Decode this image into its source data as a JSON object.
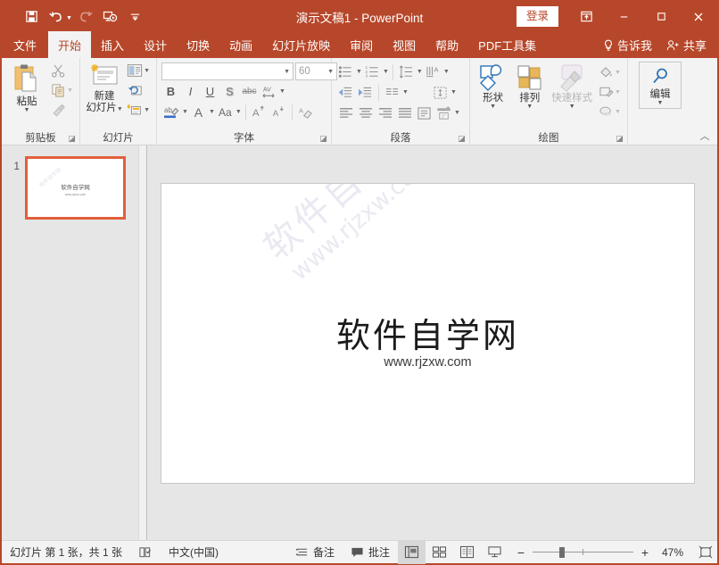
{
  "titlebar": {
    "document_title": "演示文稿1  -  PowerPoint",
    "signin_label": "登录",
    "quick_access": [
      {
        "name": "save-icon",
        "label": "保存"
      },
      {
        "name": "undo-icon",
        "label": "撤销"
      },
      {
        "name": "redo-icon",
        "label": "恢复"
      },
      {
        "name": "start-slideshow-icon",
        "label": "从头开始"
      },
      {
        "name": "customize-qat-icon",
        "label": "自定义快速访问工具栏"
      }
    ],
    "window_controls": {
      "ribbon_display_options": "功能区显示选项",
      "minimize": "最小化",
      "maximize": "最大化",
      "close": "关闭"
    },
    "bg_color": "#b7472a"
  },
  "tabs": [
    {
      "label": "文件",
      "active": false
    },
    {
      "label": "开始",
      "active": true
    },
    {
      "label": "插入",
      "active": false
    },
    {
      "label": "设计",
      "active": false
    },
    {
      "label": "切换",
      "active": false
    },
    {
      "label": "动画",
      "active": false
    },
    {
      "label": "幻灯片放映",
      "active": false
    },
    {
      "label": "审阅",
      "active": false
    },
    {
      "label": "视图",
      "active": false
    },
    {
      "label": "帮助",
      "active": false
    },
    {
      "label": "PDF工具集",
      "active": false
    }
  ],
  "tab_right": {
    "tell_me": "告诉我",
    "share": "共享"
  },
  "ribbon": {
    "groups": [
      {
        "label": "剪贴板",
        "buttons": {
          "paste": "粘贴",
          "cut": "剪切",
          "copy": "复制",
          "format_painter": "格式刷"
        }
      },
      {
        "label": "幻灯片",
        "buttons": {
          "new_slide": "新建\n幻灯片",
          "new_slide_line1": "新建",
          "new_slide_line2": "幻灯片",
          "layout": "版式",
          "reset": "重设",
          "section": "节"
        }
      },
      {
        "label": "字体",
        "font_name": "",
        "font_name_placeholder": "",
        "font_size": "60",
        "buttons": {
          "bold": "B",
          "italic": "I",
          "underline": "U",
          "shadow": "S",
          "strikethrough": "abc",
          "char_spacing": "AV",
          "text_highlight": "ab",
          "font_color": "A",
          "change_case": "Aa",
          "increase_size": "A",
          "decrease_size": "A",
          "clear_formatting": "清除所有格式"
        }
      },
      {
        "label": "段落",
        "buttons": {
          "bullets": "项目符号",
          "numbering": "编号",
          "line_spacing": "行距",
          "text_direction": "文字方向",
          "decrease_indent": "减少缩进量",
          "increase_indent": "增加缩进量",
          "columns": "分栏",
          "align_text": "对齐文本",
          "align_left": "左对齐",
          "align_center": "居中",
          "align_right": "右对齐",
          "justify": "两端对齐",
          "convert_smartart": "转换为 SmartArt"
        }
      },
      {
        "label": "绘图",
        "buttons": {
          "shapes": "形状",
          "arrange": "排列",
          "quick_styles": "快速样式",
          "shape_fill": "形状填充",
          "shape_outline": "形状轮廓",
          "shape_effects": "形状效果",
          "editing": "编辑"
        }
      }
    ],
    "collapse_label": "折叠功能区"
  },
  "thumbnails": {
    "slides": [
      {
        "number": "1",
        "title": "软件自学网",
        "subtitle": "www.rjzxw.com",
        "watermark": "软件自学网",
        "selected": true
      }
    ]
  },
  "slide": {
    "title": "软件自学网",
    "subtitle": "www.rjzxw.com",
    "watermark_line1": "软件自学网",
    "watermark_line2": "www.rjzxw.com"
  },
  "statusbar": {
    "slide_count": "幻灯片 第 1 张，共 1 张",
    "spellcheck_label": "拼写检查",
    "language": "中文(中国)",
    "notes": "备注",
    "comments": "批注",
    "views": [
      {
        "name": "normal-view",
        "label": "普通视图",
        "active": true
      },
      {
        "name": "slide-sorter-view",
        "label": "幻灯片浏览",
        "active": false
      },
      {
        "name": "reading-view",
        "label": "阅读视图",
        "active": false
      },
      {
        "name": "slideshow-view",
        "label": "幻灯片放映",
        "active": false
      }
    ],
    "zoom": {
      "minus": "−",
      "plus": "+",
      "value": "47%"
    },
    "fit_label": "使幻灯片适应当前窗口"
  }
}
